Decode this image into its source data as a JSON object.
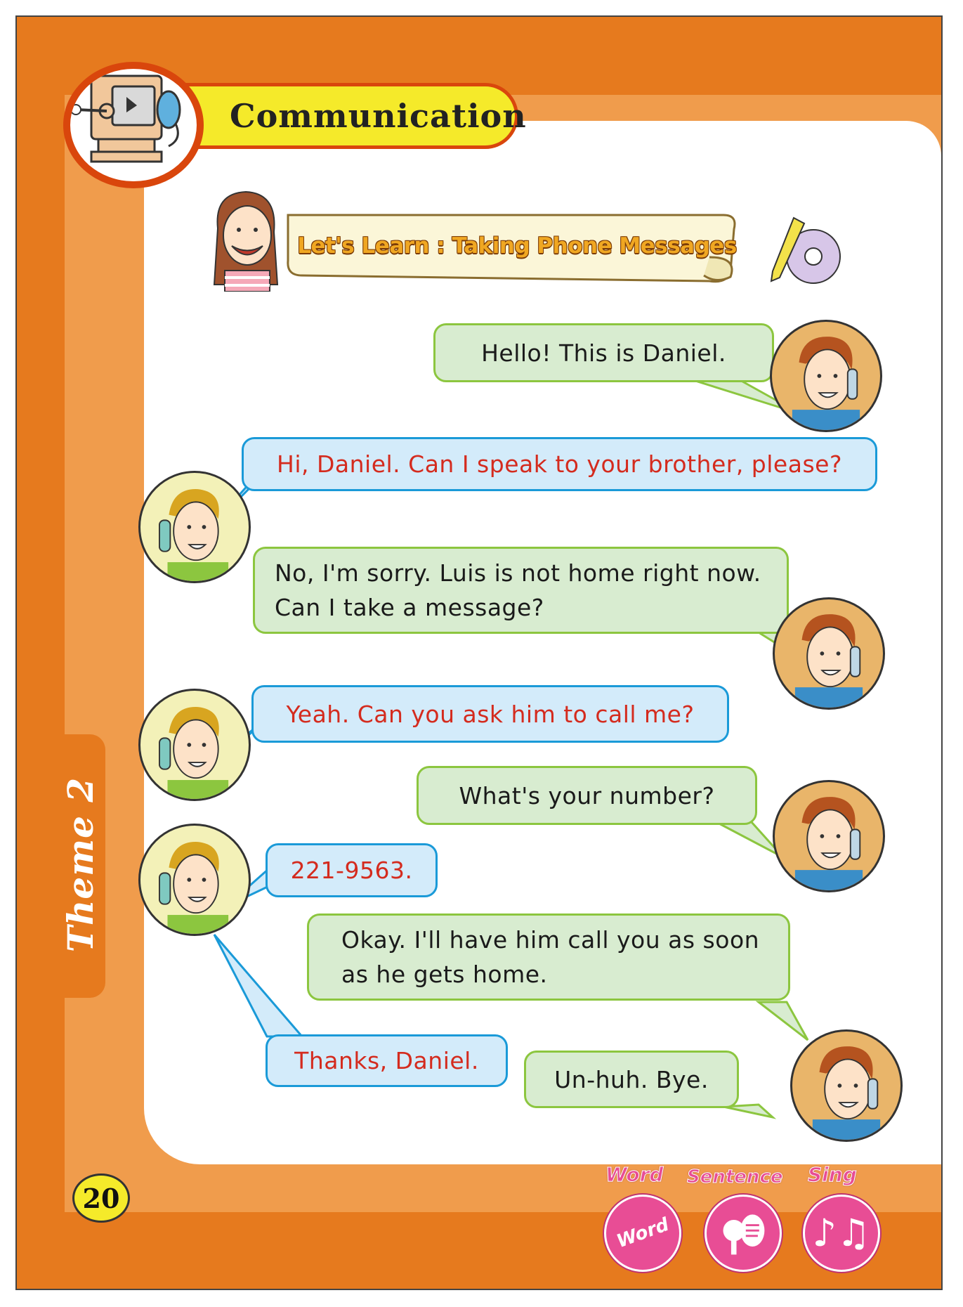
{
  "header": {
    "title": "Communication",
    "lesson_banner": "Let's Learn : Taking Phone Messages"
  },
  "sidebar": {
    "theme_label": "Theme 2"
  },
  "footer": {
    "page_number": "20",
    "controls": [
      {
        "label": "Word",
        "inner_label": "Word",
        "icon": "word-icon"
      },
      {
        "label": "Sentence",
        "icon": "sentence-icon"
      },
      {
        "label": "Sing",
        "icon": "music-notes-icon"
      }
    ]
  },
  "dialogue": [
    {
      "speaker": "daniel",
      "text": "Hello! This is Daniel."
    },
    {
      "speaker": "caller",
      "text": "Hi, Daniel. Can I speak to your brother, please?"
    },
    {
      "speaker": "daniel",
      "text": "No, I'm sorry. Luis is not home right now.\nCan I take a message?"
    },
    {
      "speaker": "caller",
      "text": "Yeah. Can you ask him to call me?"
    },
    {
      "speaker": "daniel",
      "text": "What's your number?"
    },
    {
      "speaker": "caller",
      "text": "221-9563."
    },
    {
      "speaker": "daniel",
      "text": "Okay. I'll have him call you as soon\nas he gets home."
    },
    {
      "speaker": "caller",
      "text": "Thanks, Daniel."
    },
    {
      "speaker": "daniel",
      "text": "Un-huh. Bye."
    }
  ],
  "colors": {
    "frame_orange": "#e67a1e",
    "frame_light_orange": "#f09c4c",
    "green_bubble": "#d8ecd0",
    "green_border": "#8cc63f",
    "blue_bubble": "#d3ebfa",
    "blue_border": "#1a9ad8",
    "caller_text": "#d42b1e",
    "control_pink": "#e84d95"
  }
}
